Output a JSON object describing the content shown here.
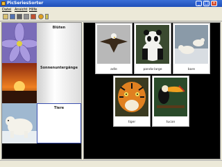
{
  "window": {
    "title": "PicSeriesSorter"
  },
  "menu": [
    {
      "label": "Datei"
    },
    {
      "label": "Ansicht"
    },
    {
      "label": "Hilfe"
    }
  ],
  "toolbar": {
    "icons": [
      "open-icon",
      "save-icon",
      "grid-icon",
      "list-icon",
      "sort-icon",
      "help-icon",
      "info-icon"
    ]
  },
  "categories": [
    {
      "label": "Blüten"
    },
    {
      "label": "Sonnenuntergänge"
    },
    {
      "label": "Tiere",
      "selected": true
    }
  ],
  "pictures": [
    {
      "label": "adle"
    },
    {
      "label": "panda-large"
    },
    {
      "label": "bare"
    },
    {
      "label": "tiger"
    },
    {
      "label": "tucan"
    }
  ],
  "colors": {
    "titlebar": "#1f4fb8",
    "selection": "#3a4fb0",
    "pane_bg": "#000000"
  }
}
